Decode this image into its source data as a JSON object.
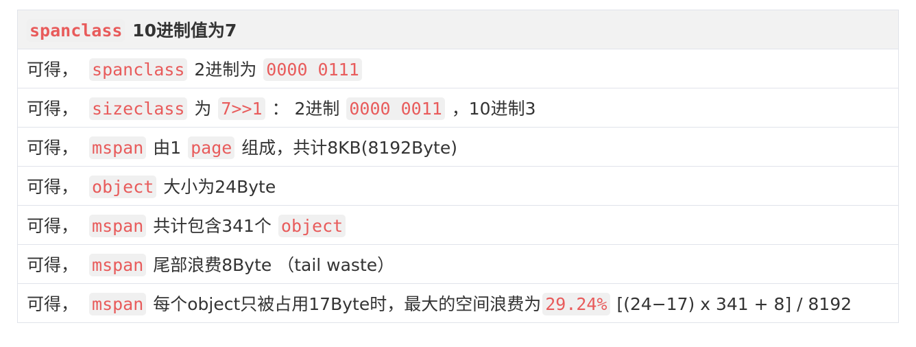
{
  "header": {
    "code": "spanclass",
    "text": " 10进制值为7"
  },
  "prefix": "可得，",
  "rows": [
    {
      "code": "spanclass",
      "text1": " 2进制为 ",
      "code2": "0000 0111"
    },
    {
      "code": "sizeclass",
      "text1": " 为 ",
      "code2": "7>>1",
      "text2": " ： 2进制 ",
      "code3": "0000 0011",
      "text3": " ，10进制3"
    },
    {
      "code": "mspan",
      "text1": " 由1 ",
      "code2": "page",
      "text2": " 组成，共计8KB(8192Byte)"
    },
    {
      "code": "object",
      "text1": " 大小为24Byte"
    },
    {
      "code": "mspan",
      "text1": " 共计包含341个 ",
      "code2": "object"
    },
    {
      "code": "mspan",
      "text1": " 尾部浪费8Byte （tail waste）"
    },
    {
      "code": "mspan",
      "text1": " 每个object只被占用17Byte时，最大的空间浪费为",
      "code2": "29.24%",
      "text2": " [(24−17) x 341 + 8] / 8192"
    }
  ]
}
